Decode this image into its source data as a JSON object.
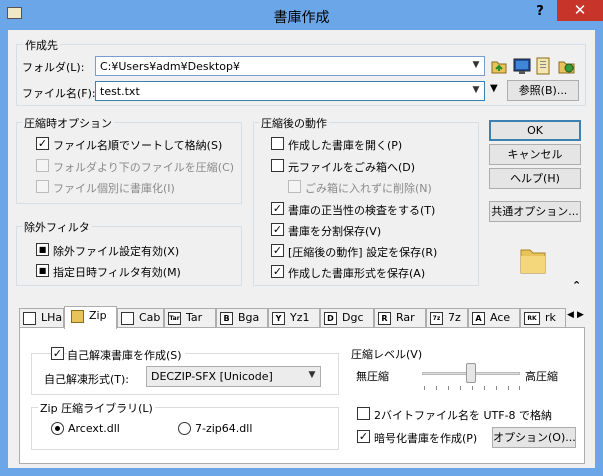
{
  "window": {
    "title": "書庫作成",
    "help_glyph": "?",
    "close_glyph": "✕"
  },
  "dest": {
    "group_label": "作成先",
    "folder_label": "フォルダ(L):",
    "folder_value": "C:¥Users¥adm¥Desktop¥",
    "filename_label": "ファイル名(F):",
    "filename_value": "test.txt",
    "browse_label": "参照(B)..."
  },
  "compress_opts": {
    "group_label": "圧縮時オプション",
    "items": [
      {
        "label": "ファイル名順でソートして格納(S)",
        "checked": true,
        "enabled": true
      },
      {
        "label": "フォルダより下のファイルを圧縮(C)",
        "checked": false,
        "enabled": false
      },
      {
        "label": "ファイル個別に書庫化(I)",
        "checked": false,
        "enabled": false
      }
    ]
  },
  "exclude": {
    "group_label": "除外フィルタ",
    "items": [
      {
        "label": "除外ファイル設定有効(X)",
        "checked": true
      },
      {
        "label": "指定日時フィルタ有効(M)",
        "checked": true
      }
    ]
  },
  "after": {
    "group_label": "圧縮後の動作",
    "items": [
      {
        "label": "作成した書庫を開く(P)",
        "checked": false,
        "enabled": true
      },
      {
        "label": "元ファイルをごみ箱へ(D)",
        "checked": false,
        "enabled": true
      },
      {
        "label": "ごみ箱に入れずに削除(N)",
        "checked": false,
        "enabled": false
      },
      {
        "label": "書庫の正当性の検査をする(T)",
        "checked": true,
        "enabled": true
      },
      {
        "label": "書庫を分割保存(V)",
        "checked": true,
        "enabled": true
      },
      {
        "label": "[圧縮後の動作] 設定を保存(R)",
        "checked": true,
        "enabled": true
      },
      {
        "label": "作成した書庫形式を保存(A)",
        "checked": true,
        "enabled": true
      }
    ]
  },
  "buttons": {
    "ok": "OK",
    "cancel": "キャンセル",
    "help": "ヘルプ(H)",
    "common_options": "共通オプション..."
  },
  "tabs": [
    {
      "label": "LHa",
      "icon": "lha-icon",
      "glyph": "",
      "active": false
    },
    {
      "label": "Zip",
      "icon": "zip-folder-icon",
      "glyph": "",
      "active": true
    },
    {
      "label": "Cab",
      "icon": "cab-icon",
      "glyph": "",
      "active": false
    },
    {
      "label": "Tar",
      "icon": "tar-icon",
      "glyph": "Tar",
      "active": false
    },
    {
      "label": "Bga",
      "icon": "bga-icon",
      "glyph": "B",
      "active": false
    },
    {
      "label": "Yz1",
      "icon": "yz1-icon",
      "glyph": "Y",
      "active": false
    },
    {
      "label": "Dgc",
      "icon": "dgc-icon",
      "glyph": "D",
      "active": false
    },
    {
      "label": "Rar",
      "icon": "rar-icon",
      "glyph": "R",
      "active": false
    },
    {
      "label": "7z",
      "icon": "7z-icon",
      "glyph": "7z",
      "active": false
    },
    {
      "label": "Ace",
      "icon": "ace-icon",
      "glyph": "A",
      "active": false
    },
    {
      "label": "rk",
      "icon": "rk-icon",
      "glyph": "RK",
      "active": false
    }
  ],
  "zip": {
    "sfx_group_check_label": "自己解凍書庫を作成(S)",
    "sfx_checked": true,
    "sfx_format_label": "自己解凍形式(T):",
    "sfx_format_value": "DECZIP-SFX [Unicode]",
    "lib_group_label": "Zip 圧縮ライブラリ(L)",
    "lib_options": [
      {
        "label": "Arcext.dll",
        "selected": true
      },
      {
        "label": "7-zip64.dll",
        "selected": false
      }
    ],
    "level_group_label": "圧縮レベル(V)",
    "level_min_label": "無圧縮",
    "level_max_label": "高圧縮",
    "level_value": 0.5,
    "utf8_label": "2バイトファイル名を UTF-8 で格納",
    "utf8_checked": false,
    "encrypt_label": "暗号化書庫を作成(P)",
    "encrypt_checked": true,
    "options_button": "オプション(O)..."
  },
  "colors": {
    "title_bar": "#6aa6e8",
    "close_button": "#c7342a",
    "dialog_bg": "#f0f0f0"
  }
}
